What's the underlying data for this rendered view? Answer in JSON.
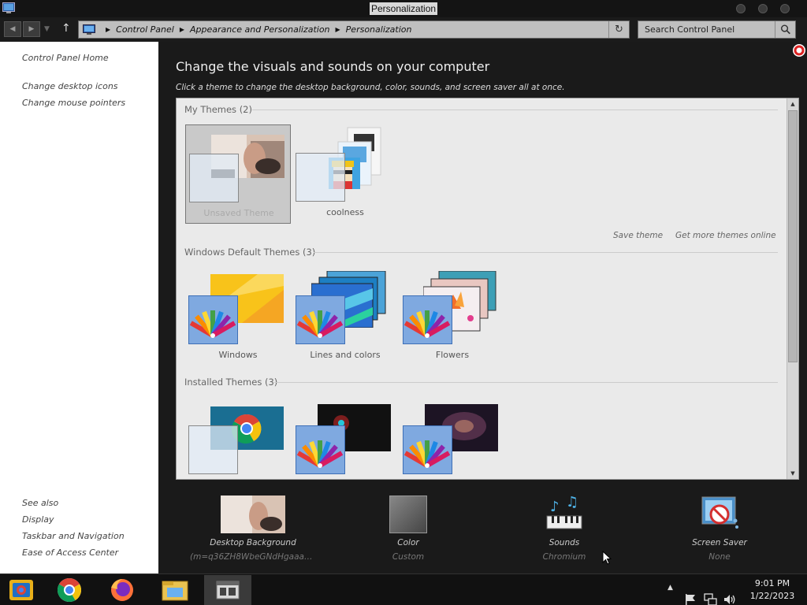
{
  "window": {
    "title": "Personalization"
  },
  "address": {
    "crumbs": [
      "Control Panel",
      "Appearance and Personalization",
      "Personalization"
    ],
    "search_placeholder": "Search Control Panel"
  },
  "left_nav": {
    "top_links": [
      "Control Panel Home",
      "Change desktop icons",
      "Change mouse pointers"
    ],
    "see_also_title": "See also",
    "see_also": [
      "Display",
      "Taskbar and Navigation",
      "Ease of Access Center"
    ]
  },
  "main": {
    "heading": "Change the visuals and sounds on your computer",
    "subheading": "Click a theme to change the desktop background, color, sounds, and screen saver all at once.",
    "sections": {
      "my_themes": {
        "title": "My Themes (2)",
        "themes": [
          "Unsaved Theme",
          "coolness"
        ]
      },
      "default_themes": {
        "title": "Windows Default Themes (3)",
        "themes": [
          "Windows",
          "Lines and colors",
          "Flowers"
        ]
      },
      "installed_themes": {
        "title": "Installed Themes (3)"
      }
    },
    "links": {
      "save_theme": "Save theme",
      "get_more": "Get more themes online"
    }
  },
  "settings": [
    {
      "name": "Desktop Background",
      "value": "(m=q36ZH8WbeGNdHgaaaa)(mh=J..."
    },
    {
      "name": "Color",
      "value": "Custom"
    },
    {
      "name": "Sounds",
      "value": "Chromium"
    },
    {
      "name": "Screen Saver",
      "value": "None"
    }
  ],
  "taskbar": {
    "time": "9:01 PM",
    "date": "1/22/2023"
  },
  "colors": {
    "accent_blue": "#7fa9e0",
    "chrome_red": "#db4437"
  }
}
